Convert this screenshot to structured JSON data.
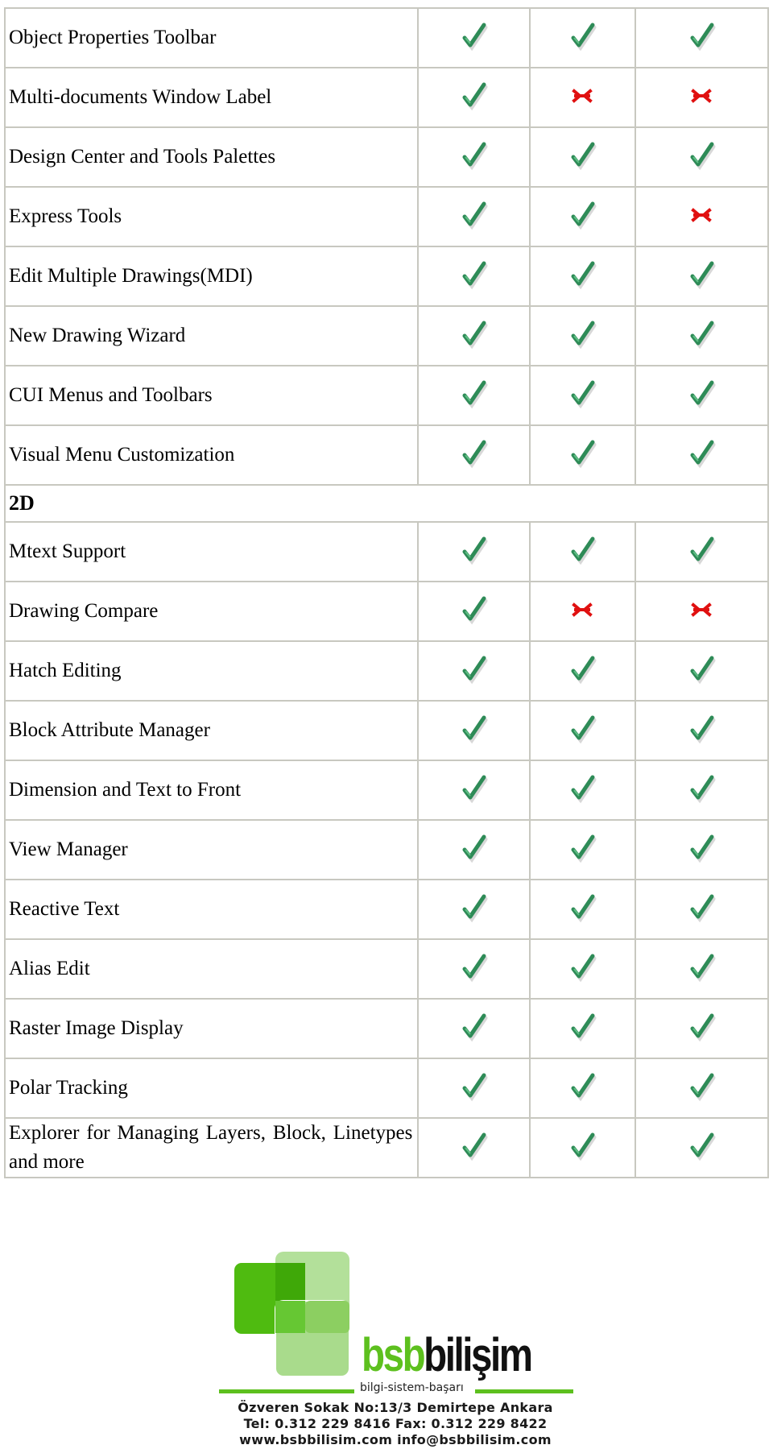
{
  "table": {
    "rows": [
      {
        "type": "feature",
        "name": "Object Properties Toolbar",
        "marks": [
          "check",
          "check",
          "check"
        ]
      },
      {
        "type": "feature",
        "name": "Multi-documents Window Label",
        "marks": [
          "check",
          "cross",
          "cross"
        ]
      },
      {
        "type": "feature",
        "name": "Design Center and Tools Palettes",
        "marks": [
          "check",
          "check",
          "check"
        ]
      },
      {
        "type": "feature",
        "name": "Express Tools",
        "marks": [
          "check",
          "check",
          "cross"
        ]
      },
      {
        "type": "feature",
        "name": "Edit Multiple Drawings(MDI)",
        "marks": [
          "check",
          "check",
          "check"
        ]
      },
      {
        "type": "feature",
        "name": "New Drawing Wizard",
        "marks": [
          "check",
          "check",
          "check"
        ]
      },
      {
        "type": "feature",
        "name": "CUI Menus and Toolbars",
        "marks": [
          "check",
          "check",
          "check"
        ]
      },
      {
        "type": "feature",
        "name": "Visual Menu Customization",
        "marks": [
          "check",
          "check",
          "check"
        ]
      },
      {
        "type": "section",
        "name": "2D"
      },
      {
        "type": "feature",
        "name": "Mtext Support",
        "marks": [
          "check",
          "check",
          "check"
        ]
      },
      {
        "type": "feature",
        "name": "Drawing Compare",
        "marks": [
          "check",
          "cross",
          "cross"
        ]
      },
      {
        "type": "feature",
        "name": "Hatch Editing",
        "marks": [
          "check",
          "check",
          "check"
        ]
      },
      {
        "type": "feature",
        "name": "Block Attribute Manager",
        "marks": [
          "check",
          "check",
          "check"
        ]
      },
      {
        "type": "feature",
        "name": "Dimension and Text to Front",
        "marks": [
          "check",
          "check",
          "check"
        ]
      },
      {
        "type": "feature",
        "name": "View Manager",
        "marks": [
          "check",
          "check",
          "check"
        ]
      },
      {
        "type": "feature",
        "name": "Reactive Text",
        "marks": [
          "check",
          "check",
          "check"
        ]
      },
      {
        "type": "feature",
        "name": "Alias Edit",
        "marks": [
          "check",
          "check",
          "check"
        ]
      },
      {
        "type": "feature",
        "name": "Raster Image Display",
        "marks": [
          "check",
          "check",
          "check"
        ]
      },
      {
        "type": "feature",
        "name": "Polar Tracking",
        "marks": [
          "check",
          "check",
          "check"
        ]
      },
      {
        "type": "feature",
        "name": "Explorer for Managing Layers, Block, Linetypes and more",
        "marks": [
          "check",
          "check",
          "check"
        ],
        "wrap": true
      }
    ]
  },
  "icons": {
    "check": "check-icon",
    "cross": "cross-icon"
  },
  "colors": {
    "check": "#2e8b57",
    "cross": "#e01010",
    "brand_green": "#5dc01e",
    "border": "#c8c8c0"
  },
  "footer": {
    "brand_green": "bsb",
    "brand_dark": "bilişim",
    "tagline": "bilgi-sistem-başarı",
    "address": "Özveren Sokak No:13/3 Demirtepe Ankara",
    "phone": "Tel: 0.312 229 8416 Fax: 0.312 229 8422",
    "web": "www.bsbbilisim.com info@bsbbilisim.com"
  }
}
